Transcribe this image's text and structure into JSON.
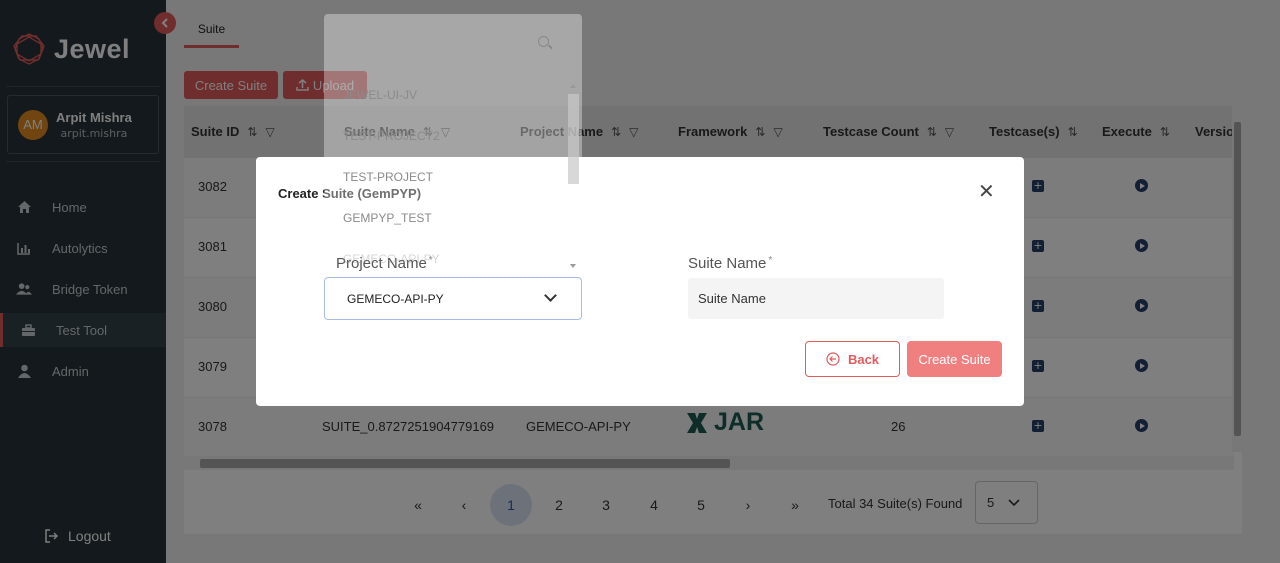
{
  "app": {
    "name": "Jewel"
  },
  "user": {
    "initials": "AM",
    "name": "Arpit Mishra",
    "handle": "arpit.mishra"
  },
  "nav": [
    {
      "label": "Home",
      "icon": "home-icon"
    },
    {
      "label": "Autolytics",
      "icon": "chart-icon"
    },
    {
      "label": "Bridge Token",
      "icon": "users-icon"
    },
    {
      "label": "Test Tool",
      "icon": "toolbox-icon",
      "active": true
    },
    {
      "label": "Admin",
      "icon": "person-icon"
    }
  ],
  "logout_label": "Logout",
  "tab": {
    "label": "Suite"
  },
  "toolbar": {
    "create_label": "Create Suite",
    "upload_label": "Upload"
  },
  "table": {
    "headers": [
      "Suite ID",
      "Suite Name",
      "Project Name",
      "Framework",
      "Testcase Count",
      "Testcase(s)",
      "Execute",
      "Versio"
    ],
    "rows": [
      {
        "id": "3082"
      },
      {
        "id": "3081"
      },
      {
        "id": "3080"
      },
      {
        "id": "3079"
      },
      {
        "id": "3078",
        "suite_name": "SUITE_0.8727251904779169",
        "project": "GEMECO-API-PY",
        "framework": "JAR",
        "count": "26"
      }
    ]
  },
  "pagination": {
    "first": "«",
    "prev": "‹",
    "pages": [
      "1",
      "2",
      "3",
      "4",
      "5"
    ],
    "current": "1",
    "next": "›",
    "last": "»",
    "total_text": "Total 34 Suite(s) Found",
    "per_page": "5"
  },
  "modal": {
    "title": "Create Suite (GemPYP)",
    "project_label": "Project Name",
    "project_value": "GEMECO-API-PY",
    "suite_label": "Suite Name",
    "suite_placeholder": "Suite Name",
    "required_mark": "*",
    "back_label": "Back",
    "create_label": "Create Suite"
  },
  "dropdown": {
    "options": [
      "JEWEL-UI-JV",
      "TEST-PROJECT2",
      "TEST-PROJECT",
      "GEMPYP_TEST",
      "GEMECO-API-PY"
    ]
  },
  "colors": {
    "accent": "#e05b5b",
    "sidebar": "#263238",
    "icon_navy": "#263f6a",
    "active_page": "#dbe4f5"
  }
}
